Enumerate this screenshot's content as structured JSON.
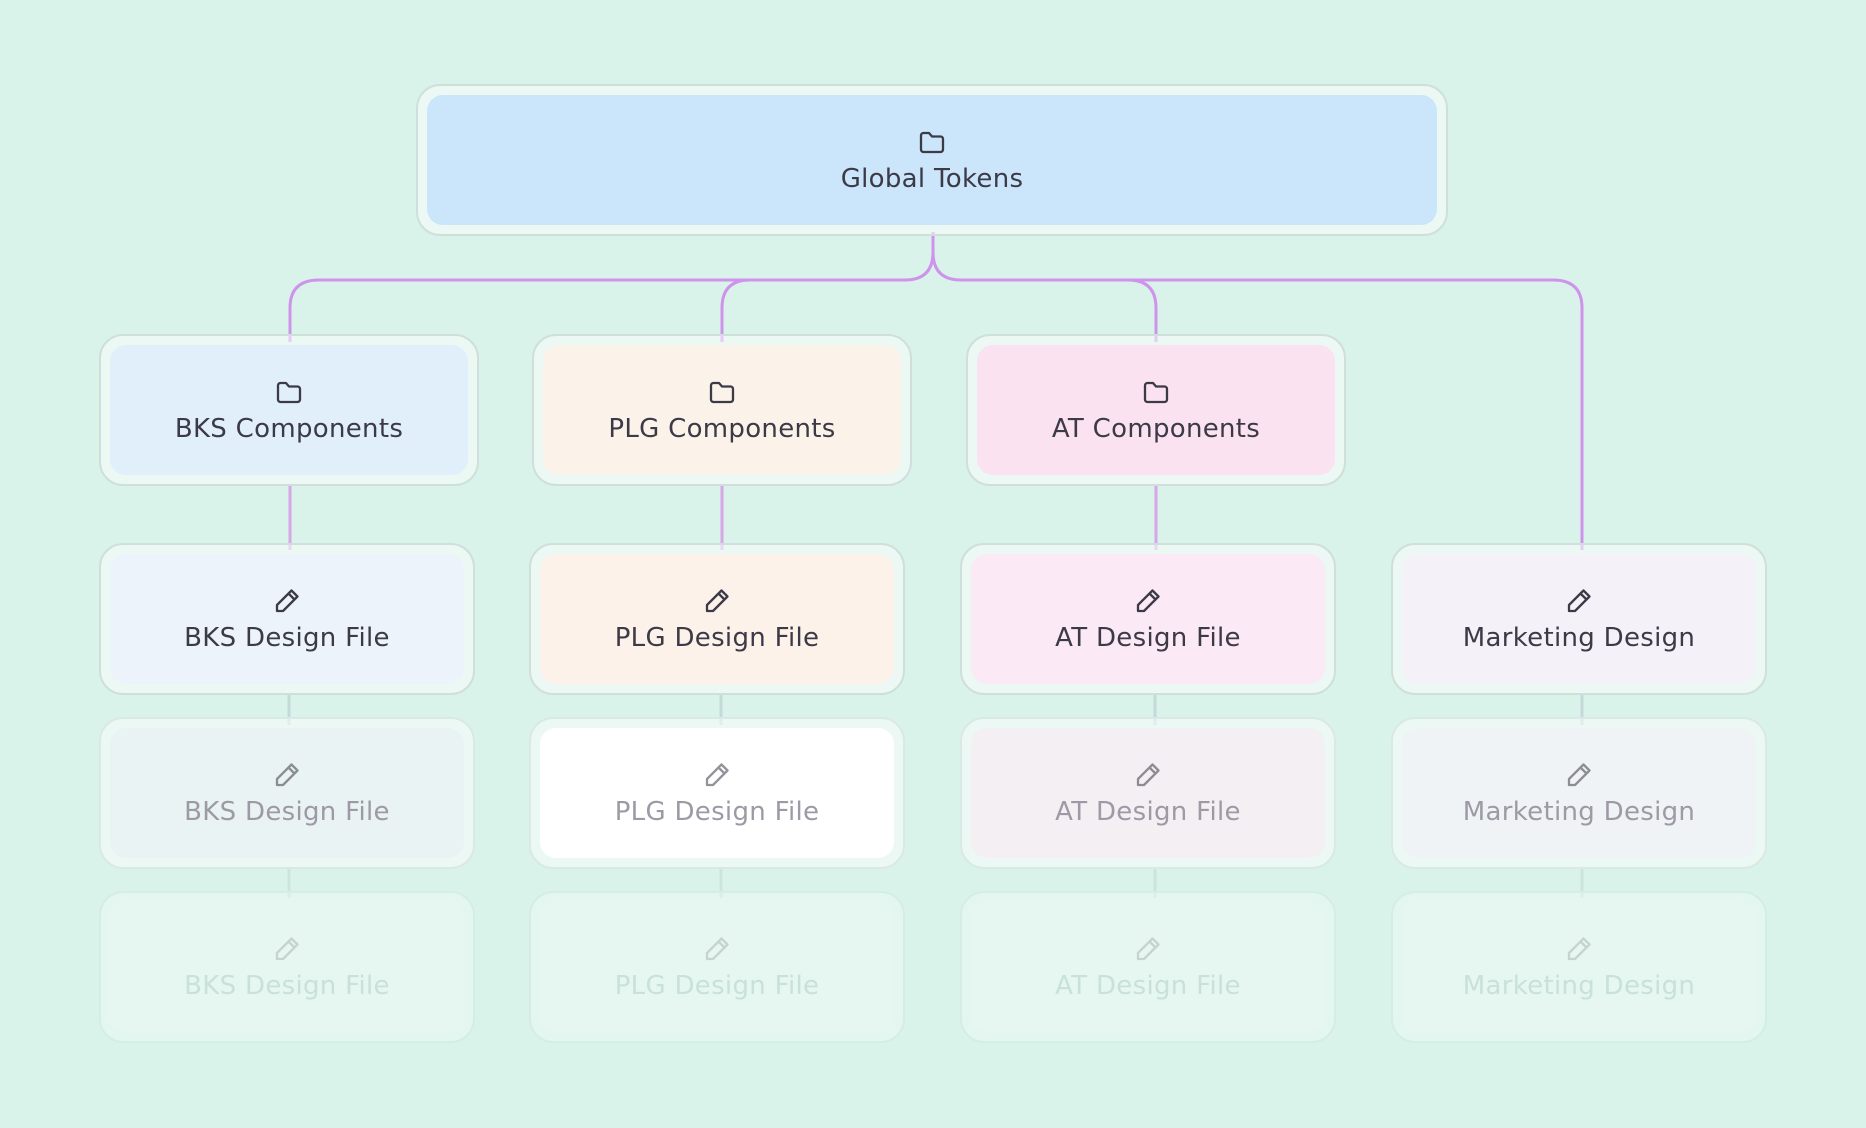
{
  "root": {
    "label": "Global Tokens",
    "icon": "folder-icon"
  },
  "components": [
    {
      "id": "bks",
      "label": "BKS Components",
      "icon": "folder-icon"
    },
    {
      "id": "plg",
      "label": "PLG Components",
      "icon": "folder-icon"
    },
    {
      "id": "at",
      "label": "AT Components",
      "icon": "folder-icon"
    }
  ],
  "design_files": [
    {
      "id": "bks",
      "label": "BKS Design File",
      "icon": "pencil-icon"
    },
    {
      "id": "plg",
      "label": "PLG Design File",
      "icon": "pencil-icon"
    },
    {
      "id": "at",
      "label": "AT Design File",
      "icon": "pencil-icon"
    },
    {
      "id": "marketing",
      "label": "Marketing Design",
      "icon": "pencil-icon"
    }
  ],
  "design_files_faded": [
    {
      "id": "bks",
      "label": "BKS Design File",
      "icon": "pencil-icon"
    },
    {
      "id": "plg",
      "label": "PLG Design File",
      "icon": "pencil-icon"
    },
    {
      "id": "at",
      "label": "AT Design File",
      "icon": "pencil-icon"
    },
    {
      "id": "marketing",
      "label": "Marketing Design",
      "icon": "pencil-icon"
    }
  ],
  "design_files_faded_2": [
    {
      "id": "bks",
      "label": "BKS Design File",
      "icon": "pencil-icon"
    },
    {
      "id": "plg",
      "label": "PLG Design File",
      "icon": "pencil-icon"
    },
    {
      "id": "at",
      "label": "AT Design File",
      "icon": "pencil-icon"
    },
    {
      "id": "marketing",
      "label": "Marketing Design",
      "icon": "pencil-icon"
    }
  ],
  "colors": {
    "background": "#d9f3ea",
    "connector": "#cf93ec",
    "connector_faint": "#c3d6d6",
    "global_tokens": "#cbe5fb",
    "bks": "#e1effb",
    "plg": "#fbf3ea",
    "at": "#fbe2f0",
    "bks_file": "#ecf3fb",
    "plg_file": "#fcf2ea",
    "at_file": "#fbe9f5",
    "marketing_file": "#f4f2f8"
  }
}
